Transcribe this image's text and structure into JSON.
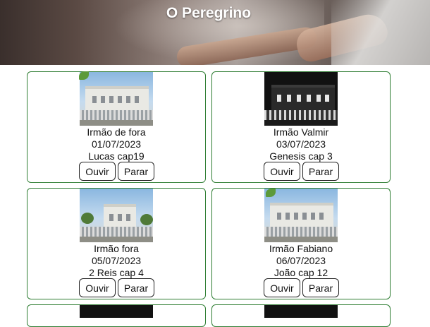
{
  "header": {
    "title": "O Peregrino"
  },
  "cards": [
    {
      "name": "Irmão de fora",
      "date": "01/07/2023",
      "passage": "Lucas cap19",
      "listen": "Ouvir",
      "stop": "Parar"
    },
    {
      "name": "Irmão Valmir",
      "date": "03/07/2023",
      "passage": "Genesis cap 3",
      "listen": "Ouvir",
      "stop": "Parar"
    },
    {
      "name": "Irmão fora",
      "date": "05/07/2023",
      "passage": "2 Reis cap 4",
      "listen": "Ouvir",
      "stop": "Parar"
    },
    {
      "name": "Irmão Fabiano",
      "date": "06/07/2023",
      "passage": "João cap 12",
      "listen": "Ouvir",
      "stop": "Parar"
    }
  ],
  "colors": {
    "card_border": "#2e7d32",
    "title_text": "#ffffff"
  }
}
